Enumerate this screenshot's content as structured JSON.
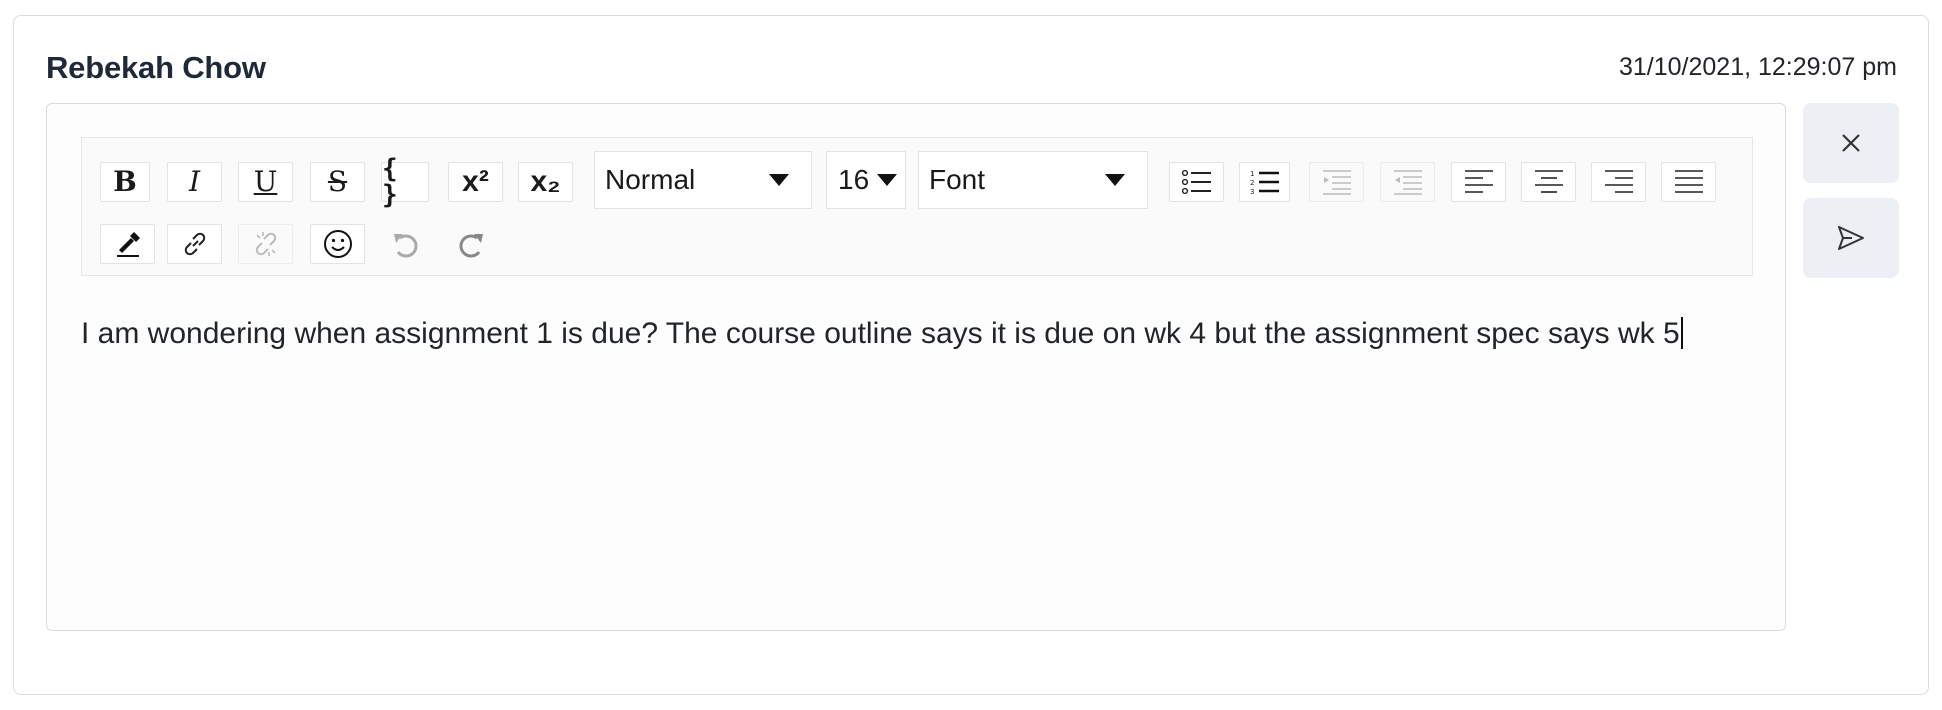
{
  "post": {
    "author": "Rebekah Chow",
    "timestamp": "31/10/2021, 12:29:07 pm"
  },
  "toolbar": {
    "bold": "B",
    "italic": "I",
    "underline": "U",
    "strikethrough": "S",
    "code": "{ }",
    "superscript": "x²",
    "subscript": "x₂",
    "block_type": "Normal",
    "font_size": "16",
    "font_family": "Font"
  },
  "editor": {
    "text": "I am wondering when assignment 1 is due? The course outline says it is due on wk 4 but the assignment spec says wk 5"
  },
  "icons": {
    "close": "close-icon",
    "send": "send-icon",
    "unordered_list": "bulleted-list-icon",
    "ordered_list": "numbered-list-icon",
    "indent": "indent-icon",
    "outdent": "outdent-icon",
    "align_left": "align-left-icon",
    "align_center": "align-center-icon",
    "align_right": "align-right-icon",
    "justify": "align-justify-icon",
    "color": "color-picker-icon",
    "link": "link-icon",
    "unlink": "unlink-icon",
    "emoji": "emoji-icon",
    "undo": "undo-icon",
    "redo": "redo-icon"
  }
}
